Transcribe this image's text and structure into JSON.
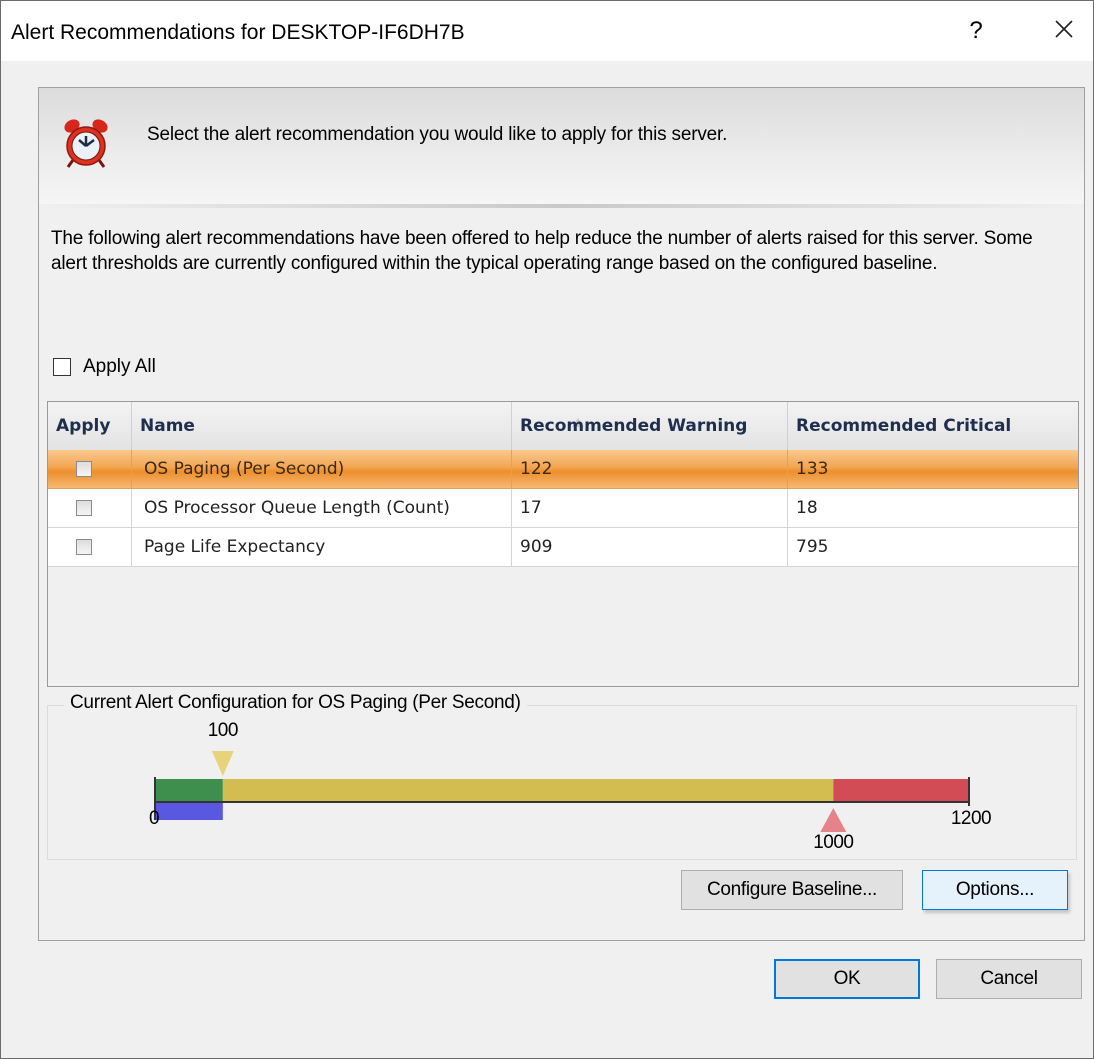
{
  "window": {
    "title": "Alert Recommendations for DESKTOP-IF6DH7B",
    "help_label": "?",
    "close_icon": "close-icon"
  },
  "banner": {
    "icon": "alarm-clock-icon",
    "text": "Select the alert recommendation you would like to apply for this server."
  },
  "description": "The following alert recommendations have been offered to help reduce the number of alerts raised for this server. Some alert thresholds are currently configured within the typical operating range based on the configured baseline.",
  "apply_all": {
    "label": "Apply All",
    "checked": false
  },
  "grid": {
    "columns": [
      "Apply",
      "Name",
      "Recommended Warning",
      "Recommended Critical"
    ],
    "sorted_column": "Name",
    "rows": [
      {
        "checked": false,
        "name": "OS Paging (Per Second)",
        "warning": "122",
        "critical": "133",
        "selected": true
      },
      {
        "checked": false,
        "name": "OS Processor Queue Length (Count)",
        "warning": "17",
        "critical": "18",
        "selected": false
      },
      {
        "checked": false,
        "name": "Page Life Expectancy",
        "warning": "909",
        "critical": "795",
        "selected": false
      }
    ]
  },
  "current_config": {
    "label": "Current Alert Configuration for OS Paging (Per Second)",
    "min_label": "0",
    "max_label": "1200",
    "warning_label": "100",
    "critical_label": "1000",
    "range": [
      0,
      1200
    ],
    "warning_threshold": 100,
    "critical_threshold": 1000,
    "baseline_range": [
      0,
      100
    ],
    "colors": {
      "ok": "#3e8e4e",
      "warning": "#d4bd50",
      "critical": "#d24c55",
      "baseline": "#5a57e0",
      "warning_marker": "#e8d37a",
      "critical_marker": "#e4838a"
    }
  },
  "buttons": {
    "configure_baseline": "Configure Baseline...",
    "options": "Options...",
    "ok": "OK",
    "cancel": "Cancel"
  }
}
